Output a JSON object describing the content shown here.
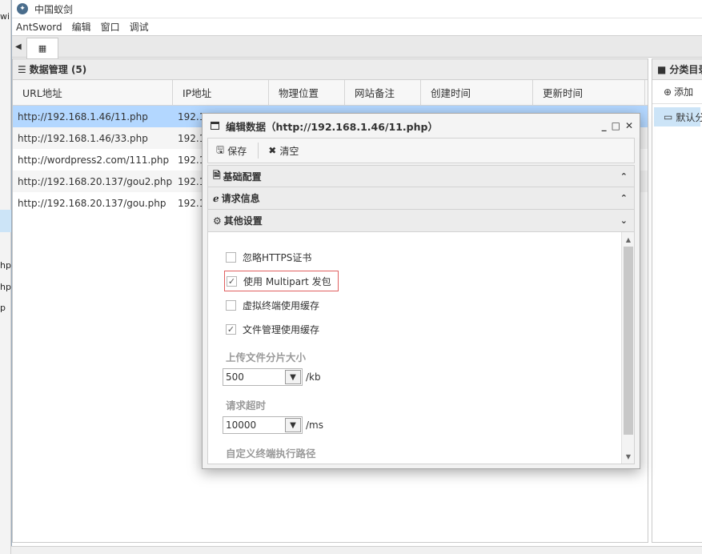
{
  "window": {
    "title": "中国蚁剑"
  },
  "menu": [
    "AntSword",
    "编辑",
    "窗口",
    "调试"
  ],
  "tabbar": {
    "home_icon": "grid-icon"
  },
  "data_panel": {
    "header": "数据管理 (5)",
    "columns": [
      "URL地址",
      "IP地址",
      "物理位置",
      "网站备注",
      "创建时间",
      "更新时间"
    ],
    "rows": [
      {
        "url": "http://192.168.1.46/11.php",
        "ip": "192.1"
      },
      {
        "url": "http://192.168.1.46/33.php",
        "ip": "192.1"
      },
      {
        "url": "http://wordpress2.com/111.php",
        "ip": "192.1"
      },
      {
        "url": "http://192.168.20.137/gou2.php",
        "ip": "192.1"
      },
      {
        "url": "http://192.168.20.137/gou.php",
        "ip": "192.1"
      }
    ]
  },
  "category_panel": {
    "header": "分类目录",
    "add": "添加",
    "item": "默认分类"
  },
  "left_edge": {
    "frag1": "wi",
    "frag2": "hp",
    "frag3": "hp",
    "frag4": "p"
  },
  "dialog": {
    "title": "编辑数据（http://192.168.1.46/11.php）",
    "controls": {
      "min": "_",
      "max": "□",
      "close": "✕"
    },
    "toolbar": {
      "save": "保存",
      "clear": "清空"
    },
    "sections": {
      "basic": "基础配置",
      "request": "请求信息",
      "other": "其他设置"
    },
    "options": {
      "ignore_https": "忽略HTTPS证书",
      "multipart": "使用 Multipart 发包",
      "terminal_cache": "虚拟终端使用缓存",
      "file_cache": "文件管理使用缓存"
    },
    "chunk_label": "上传文件分片大小",
    "chunk_value": "500",
    "chunk_unit": "/kb",
    "timeout_label": "请求超时",
    "timeout_value": "10000",
    "timeout_unit": "/ms",
    "custom_path_label": "自定义终端执行路径"
  }
}
